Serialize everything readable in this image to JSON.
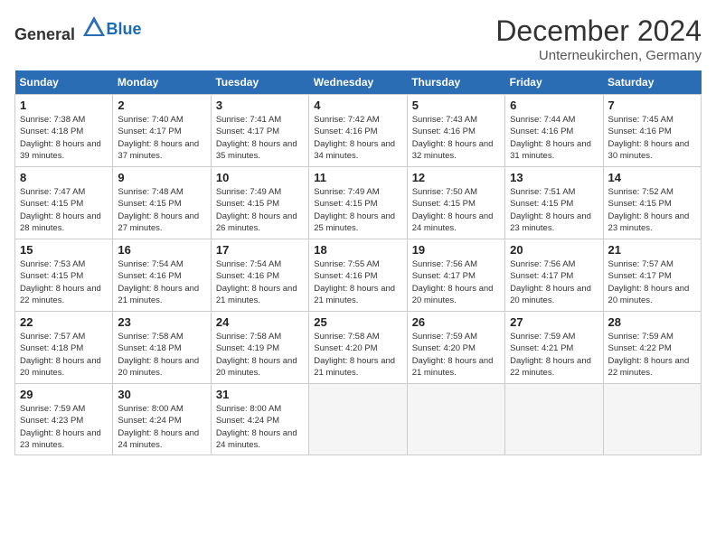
{
  "header": {
    "logo_general": "General",
    "logo_blue": "Blue",
    "month_title": "December 2024",
    "location": "Unterneukirchen, Germany"
  },
  "days_of_week": [
    "Sunday",
    "Monday",
    "Tuesday",
    "Wednesday",
    "Thursday",
    "Friday",
    "Saturday"
  ],
  "weeks": [
    [
      {
        "day": "1",
        "sunrise": "Sunrise: 7:38 AM",
        "sunset": "Sunset: 4:18 PM",
        "daylight": "Daylight: 8 hours and 39 minutes."
      },
      {
        "day": "2",
        "sunrise": "Sunrise: 7:40 AM",
        "sunset": "Sunset: 4:17 PM",
        "daylight": "Daylight: 8 hours and 37 minutes."
      },
      {
        "day": "3",
        "sunrise": "Sunrise: 7:41 AM",
        "sunset": "Sunset: 4:17 PM",
        "daylight": "Daylight: 8 hours and 35 minutes."
      },
      {
        "day": "4",
        "sunrise": "Sunrise: 7:42 AM",
        "sunset": "Sunset: 4:16 PM",
        "daylight": "Daylight: 8 hours and 34 minutes."
      },
      {
        "day": "5",
        "sunrise": "Sunrise: 7:43 AM",
        "sunset": "Sunset: 4:16 PM",
        "daylight": "Daylight: 8 hours and 32 minutes."
      },
      {
        "day": "6",
        "sunrise": "Sunrise: 7:44 AM",
        "sunset": "Sunset: 4:16 PM",
        "daylight": "Daylight: 8 hours and 31 minutes."
      },
      {
        "day": "7",
        "sunrise": "Sunrise: 7:45 AM",
        "sunset": "Sunset: 4:16 PM",
        "daylight": "Daylight: 8 hours and 30 minutes."
      }
    ],
    [
      {
        "day": "8",
        "sunrise": "Sunrise: 7:47 AM",
        "sunset": "Sunset: 4:15 PM",
        "daylight": "Daylight: 8 hours and 28 minutes."
      },
      {
        "day": "9",
        "sunrise": "Sunrise: 7:48 AM",
        "sunset": "Sunset: 4:15 PM",
        "daylight": "Daylight: 8 hours and 27 minutes."
      },
      {
        "day": "10",
        "sunrise": "Sunrise: 7:49 AM",
        "sunset": "Sunset: 4:15 PM",
        "daylight": "Daylight: 8 hours and 26 minutes."
      },
      {
        "day": "11",
        "sunrise": "Sunrise: 7:49 AM",
        "sunset": "Sunset: 4:15 PM",
        "daylight": "Daylight: 8 hours and 25 minutes."
      },
      {
        "day": "12",
        "sunrise": "Sunrise: 7:50 AM",
        "sunset": "Sunset: 4:15 PM",
        "daylight": "Daylight: 8 hours and 24 minutes."
      },
      {
        "day": "13",
        "sunrise": "Sunrise: 7:51 AM",
        "sunset": "Sunset: 4:15 PM",
        "daylight": "Daylight: 8 hours and 23 minutes."
      },
      {
        "day": "14",
        "sunrise": "Sunrise: 7:52 AM",
        "sunset": "Sunset: 4:15 PM",
        "daylight": "Daylight: 8 hours and 23 minutes."
      }
    ],
    [
      {
        "day": "15",
        "sunrise": "Sunrise: 7:53 AM",
        "sunset": "Sunset: 4:15 PM",
        "daylight": "Daylight: 8 hours and 22 minutes."
      },
      {
        "day": "16",
        "sunrise": "Sunrise: 7:54 AM",
        "sunset": "Sunset: 4:16 PM",
        "daylight": "Daylight: 8 hours and 21 minutes."
      },
      {
        "day": "17",
        "sunrise": "Sunrise: 7:54 AM",
        "sunset": "Sunset: 4:16 PM",
        "daylight": "Daylight: 8 hours and 21 minutes."
      },
      {
        "day": "18",
        "sunrise": "Sunrise: 7:55 AM",
        "sunset": "Sunset: 4:16 PM",
        "daylight": "Daylight: 8 hours and 21 minutes."
      },
      {
        "day": "19",
        "sunrise": "Sunrise: 7:56 AM",
        "sunset": "Sunset: 4:17 PM",
        "daylight": "Daylight: 8 hours and 20 minutes."
      },
      {
        "day": "20",
        "sunrise": "Sunrise: 7:56 AM",
        "sunset": "Sunset: 4:17 PM",
        "daylight": "Daylight: 8 hours and 20 minutes."
      },
      {
        "day": "21",
        "sunrise": "Sunrise: 7:57 AM",
        "sunset": "Sunset: 4:17 PM",
        "daylight": "Daylight: 8 hours and 20 minutes."
      }
    ],
    [
      {
        "day": "22",
        "sunrise": "Sunrise: 7:57 AM",
        "sunset": "Sunset: 4:18 PM",
        "daylight": "Daylight: 8 hours and 20 minutes."
      },
      {
        "day": "23",
        "sunrise": "Sunrise: 7:58 AM",
        "sunset": "Sunset: 4:18 PM",
        "daylight": "Daylight: 8 hours and 20 minutes."
      },
      {
        "day": "24",
        "sunrise": "Sunrise: 7:58 AM",
        "sunset": "Sunset: 4:19 PM",
        "daylight": "Daylight: 8 hours and 20 minutes."
      },
      {
        "day": "25",
        "sunrise": "Sunrise: 7:58 AM",
        "sunset": "Sunset: 4:20 PM",
        "daylight": "Daylight: 8 hours and 21 minutes."
      },
      {
        "day": "26",
        "sunrise": "Sunrise: 7:59 AM",
        "sunset": "Sunset: 4:20 PM",
        "daylight": "Daylight: 8 hours and 21 minutes."
      },
      {
        "day": "27",
        "sunrise": "Sunrise: 7:59 AM",
        "sunset": "Sunset: 4:21 PM",
        "daylight": "Daylight: 8 hours and 22 minutes."
      },
      {
        "day": "28",
        "sunrise": "Sunrise: 7:59 AM",
        "sunset": "Sunset: 4:22 PM",
        "daylight": "Daylight: 8 hours and 22 minutes."
      }
    ],
    [
      {
        "day": "29",
        "sunrise": "Sunrise: 7:59 AM",
        "sunset": "Sunset: 4:23 PM",
        "daylight": "Daylight: 8 hours and 23 minutes."
      },
      {
        "day": "30",
        "sunrise": "Sunrise: 8:00 AM",
        "sunset": "Sunset: 4:24 PM",
        "daylight": "Daylight: 8 hours and 24 minutes."
      },
      {
        "day": "31",
        "sunrise": "Sunrise: 8:00 AM",
        "sunset": "Sunset: 4:24 PM",
        "daylight": "Daylight: 8 hours and 24 minutes."
      },
      null,
      null,
      null,
      null
    ]
  ]
}
